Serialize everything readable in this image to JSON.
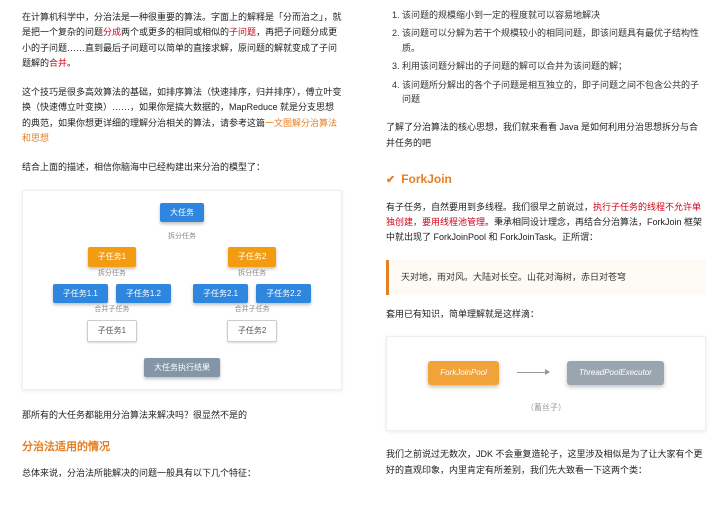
{
  "left": {
    "p1_a": "在计算机科学中，分治法是一种很重要的算法。字面上的解释是「分而治之」，就是把一个复杂的问题",
    "p1_red1": "分成",
    "p1_b": "两个或更多的相同或相似的",
    "p1_red2": "子问题",
    "p1_c": "，再把子问题分成更小的子问题……直到最后子问题可以简单的直接求解，原问题的解就变成了子问题解的",
    "p1_red3": "合并",
    "p1_d": "。",
    "p2_a": "这个技巧是很多高效算法的基础，如排序算法（快速排序，归并排序），傅立叶变换（快速傅立叶变换）……，如果你是搞大数据的，MapReduce 就是分支思想的典范，如果你想更详细的理解分治相关的算法，请参考这篇",
    "p2_link": "一文图解分治算法和思想",
    "p3": "结合上面的描述，相信你脑海中已经构建出来分治的模型了：",
    "diagram": {
      "root": "大任务",
      "split_label": "拆分任务",
      "sub1": "子任务1",
      "sub2": "子任务2",
      "sub1_1": "子任务1.1",
      "sub1_2": "子任务1.2",
      "sub2_1": "子任务2.1",
      "sub2_2": "子任务2.2",
      "merge_label_l": "合并子任务",
      "merge_label_r": "合并子任务",
      "merge1": "子任务1",
      "merge2": "子任务2",
      "final": "大任务执行结果"
    },
    "p4": "那所有的大任务都能用分治算法来解决吗？很显然不是的",
    "section_title": "分治法适用的情况",
    "p5": "总体来说，分治法所能解决的问题一般具有以下几个特征："
  },
  "right": {
    "ol": [
      "该问题的规模缩小到一定的程度就可以容易地解决",
      "该问题可以分解为若干个规模较小的相同问题，即该问题具有最优子结构性质。",
      "利用该问题分解出的子问题的解可以合并为该问题的解；",
      "该问题所分解出的各个子问题是相互独立的，即子问题之间不包含公共的子问题"
    ],
    "p1": "了解了分治算法的核心思想，我们就来看看 Java 是如何利用分治思想拆分与合并任务的吧",
    "forkjoin_title": "ForkJoin",
    "p2_a": "有子任务，自然要用到多线程。我们很早之前说过，",
    "p2_red1": "执行子任务的线程不允许单独创建，要用线程池管理",
    "p2_b": "。秉承相同设计理念，再结合分治算法，ForkJoin 框架中就出现了 ForkJoinPool 和 ForkJoinTask。正所谓：",
    "quote": "天对地，雨对风。大陆对长空。山花对海树，赤日对苍穹",
    "p3": "套用已有知识，简单理解就是这样滴：",
    "diagram2": {
      "left": "ForkJoinPool",
      "right": "ThreadPoolExecutor",
      "caption": "（蓄丝子）"
    },
    "p4": "我们之前说过无数次，JDK 不会重复造轮子，这里涉及相似是为了让大家有个更好的直观印象，内里肯定有所差别，我们先大致看一下这两个类："
  }
}
